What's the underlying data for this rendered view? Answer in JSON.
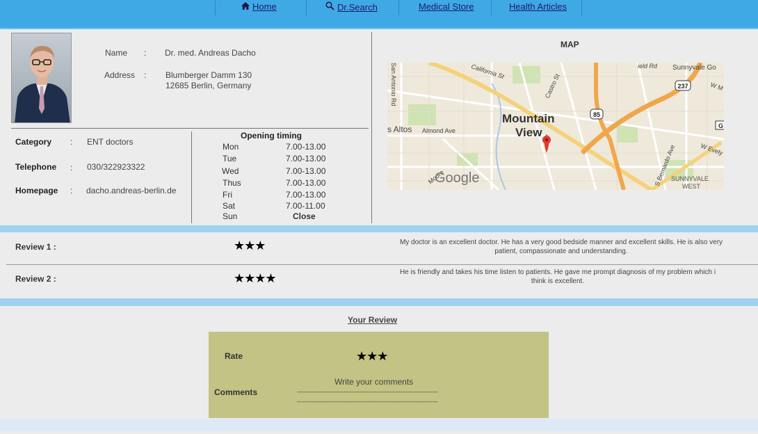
{
  "nav": {
    "home_label": "Home",
    "search_label": "Dr.Search",
    "store_label": "Medical Store",
    "articles_label": "Health Articles",
    "home_icon": "home-icon",
    "search_icon": "search-icon"
  },
  "profile": {
    "name_label": "Name",
    "name_colon": ":",
    "name": "Dr. med. Andreas Dacho",
    "address_label": "Address",
    "address_colon": ":",
    "address_line1": "Blumberger Damm 130",
    "address_line2": "12685 Berlin, Germany"
  },
  "details": {
    "category_label": "Category",
    "category_colon": ":",
    "category": "ENT doctors",
    "telephone_label": "Telephone",
    "telephone_colon": ":",
    "telephone": "030/322923322",
    "homepage_label": "Homepage",
    "homepage_colon": ":",
    "homepage": "dacho.andreas-berlin.de"
  },
  "timing": {
    "title": "Opening timing",
    "days": [
      {
        "day": "Mon",
        "time": "7.00-13.00"
      },
      {
        "day": "Tue",
        "time": "7.00-13.00"
      },
      {
        "day": "Wed",
        "time": "7.00-13.00"
      },
      {
        "day": "Thus",
        "time": "7.00-13.00"
      },
      {
        "day": "Fri",
        "time": "7.00-13.00"
      },
      {
        "day": "Sat",
        "time": "7.00-11.00"
      },
      {
        "day": "Sun",
        "time": "Close"
      }
    ]
  },
  "map": {
    "title": "MAP",
    "labels": {
      "city": "Mountain",
      "city2": "View",
      "altos": "s Altos",
      "almond": "Almond Ave",
      "california": "California St",
      "castro": "Castro St",
      "sunnyvale": "Sunnyvale Go",
      "sunnyvale_west": "SUNNYVALE",
      "west": "WEST",
      "bernardo": "S Bernardo Ave",
      "san_antonio": "San Antonio Rd",
      "field": "ield Rd",
      "moore": "Moore",
      "evely": "W Evely",
      "wm": "W M",
      "google": "Google",
      "hw237": "237",
      "hw85": "85",
      "ga": "G"
    }
  },
  "reviews": [
    {
      "label": "Review 1 :",
      "stars": "★★★",
      "rating": 3,
      "text_line1": "My doctor is an excellent doctor. He has a very good bedside manner and excellent skills. He is also very",
      "text_line2": "patient, compassionate and understanding."
    },
    {
      "label": "Review 2 :",
      "stars": "★★★★",
      "rating": 4,
      "text_line1": "He is friendly and takes his time listen to patients. He gave me prompt diagnosis of my problem which i",
      "text_line2": "think is excellent."
    }
  ],
  "your_review": {
    "title": "Your Review",
    "rate_label": "Rate",
    "rate_stars": "★★★",
    "rating": 3,
    "comments_label": "Comments",
    "comments_placeholder": "Write your comments",
    "dashes1": "----------------------------------------------------------------------------",
    "dashes2": "----------------------------------------------------------------------------"
  },
  "colors": {
    "nav_bg": "#3fa9e6",
    "separator_bar": "#9dd3f0",
    "form_bg": "#c2c384",
    "page_bg": "#ececec"
  }
}
